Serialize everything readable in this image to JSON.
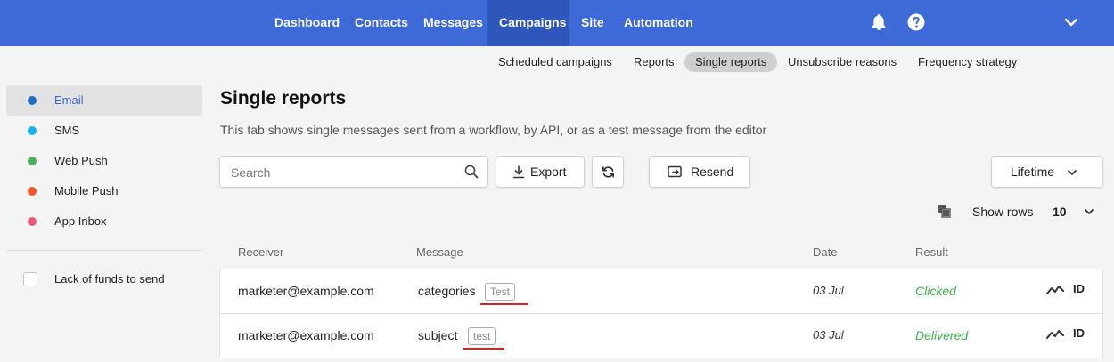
{
  "nav": {
    "items": [
      "Dashboard",
      "Contacts",
      "Messages",
      "Campaigns",
      "Site",
      "Automation"
    ],
    "active": "Campaigns"
  },
  "subtabs": {
    "items": [
      "Scheduled campaigns",
      "Reports",
      "Single reports",
      "Unsubscribe reasons",
      "Frequency strategy"
    ],
    "active": "Single reports"
  },
  "sidebar": {
    "channels": [
      {
        "label": "Email",
        "color": "#1f6fc2"
      },
      {
        "label": "SMS",
        "color": "#17b3ea"
      },
      {
        "label": "Web Push",
        "color": "#4cae58"
      },
      {
        "label": "Mobile Push",
        "color": "#ee5a24"
      },
      {
        "label": "App Inbox",
        "color": "#f0577f"
      }
    ],
    "active": "Email",
    "checkbox_label": "Lack of funds to send"
  },
  "main": {
    "title": "Single reports",
    "description": "This tab shows single messages sent from a workflow, by API, or as a test message from the editor",
    "search_placeholder": "Search",
    "export_label": "Export",
    "resend_label": "Resend",
    "period_label": "Lifetime",
    "show_rows_label": "Show rows",
    "show_rows_value": "10"
  },
  "table": {
    "headers": [
      "Receiver",
      "Message",
      "Date",
      "Result"
    ],
    "rows": [
      {
        "receiver": "marketer@example.com",
        "message": "categories",
        "tag": "Test",
        "date": "03 Jul",
        "result": "Clicked",
        "id": "ID"
      },
      {
        "receiver": "marketer@example.com",
        "message": "subject",
        "tag": "test",
        "date": "03 Jul",
        "result": "Delivered",
        "id": "ID"
      }
    ]
  },
  "colors": {
    "accent": "#3d6ad6",
    "success": "#3cb04a",
    "highlight": "#e02020"
  },
  "icons": [
    "bell-icon",
    "help-icon",
    "chevron-down-icon",
    "search-icon",
    "download-icon",
    "refresh-icon",
    "resend-icon",
    "copy-icon",
    "activity-icon"
  ]
}
